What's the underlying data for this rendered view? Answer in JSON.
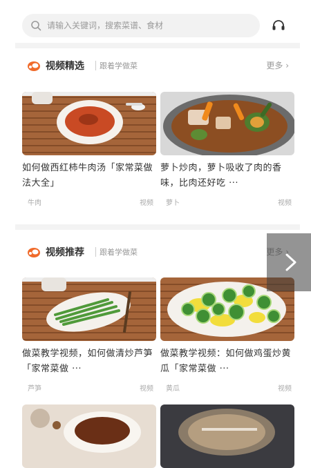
{
  "search": {
    "placeholder": "请输入关键词，搜索菜谱、食材"
  },
  "sections": [
    {
      "title": "视频精选",
      "subtitle": "跟着学做菜",
      "more": "更多",
      "cards": [
        {
          "text": "如何做西红柿牛肉汤「家常菜做法大全」",
          "tag": "牛肉",
          "type": "视频"
        },
        {
          "text": "萝卜炒肉，萝卜吸收了肉的香味，比肉还好吃 ···",
          "tag": "萝卜",
          "type": "视频"
        }
      ]
    },
    {
      "title": "视频推荐",
      "subtitle": "跟着学做菜",
      "more": "更多",
      "cards": [
        {
          "text": "做菜教学视频，如何做清炒芦笋「家常菜做 ···",
          "tag": "芦笋",
          "type": "视频"
        },
        {
          "text": "做菜教学视频：如何做鸡蛋炒黄瓜「家常菜做 ···",
          "tag": "黄瓜",
          "type": "视频"
        }
      ]
    }
  ],
  "colors": {
    "brand": "#f06a2a",
    "divider": "#f3f3f3",
    "placeholder": "#9a9a9a"
  },
  "icons": {
    "search": "search-icon",
    "service": "headset-icon",
    "section": "chef-hat-icon",
    "more": "chevron-right-icon",
    "next": "chevron-right-icon"
  }
}
